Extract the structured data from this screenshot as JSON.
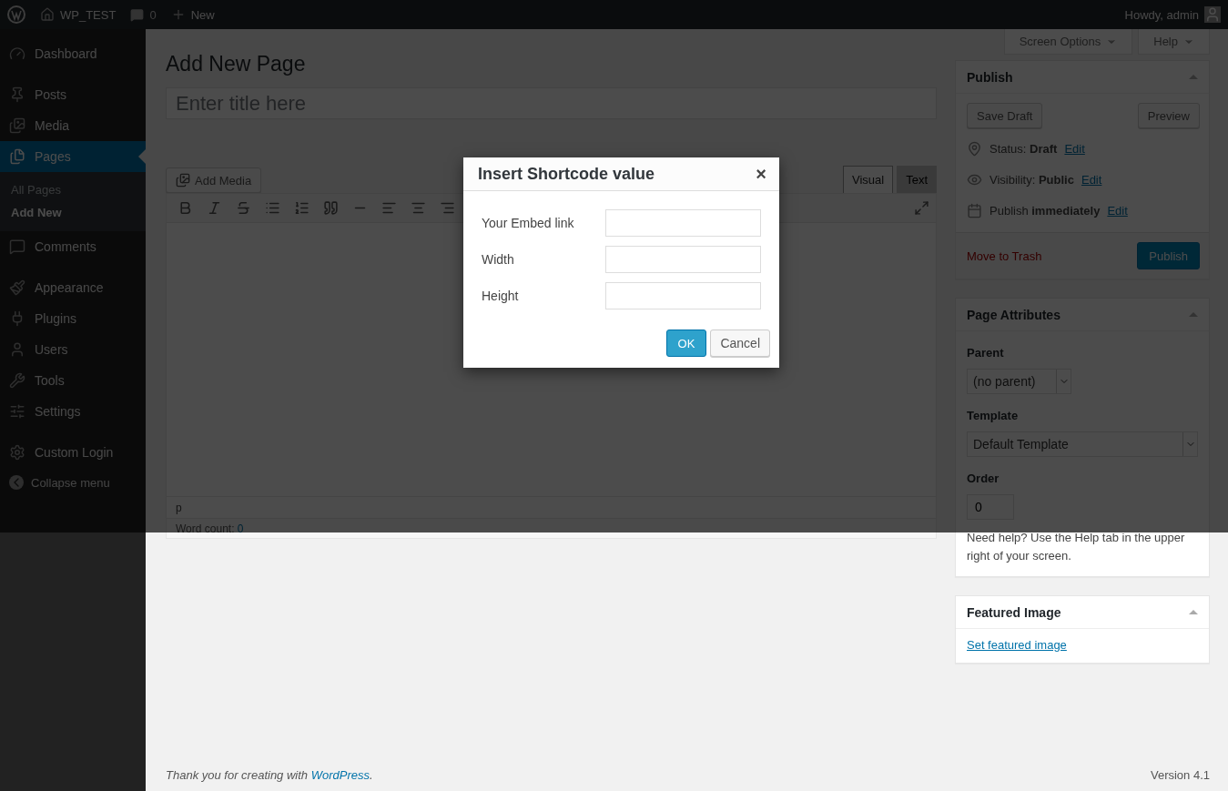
{
  "admin_bar": {
    "site": "WP_TEST",
    "comments": "0",
    "new": "New",
    "greeting": "Howdy, admin"
  },
  "sidebar": {
    "items": [
      {
        "label": "Dashboard",
        "selected": false
      },
      {
        "label": "Posts",
        "selected": false
      },
      {
        "label": "Media",
        "selected": false
      },
      {
        "label": "Pages",
        "selected": true,
        "children": [
          {
            "label": "All Pages",
            "selected": false
          },
          {
            "label": "Add New",
            "selected": true
          }
        ]
      },
      {
        "label": "Comments",
        "selected": false
      },
      {
        "label": "Appearance",
        "selected": false
      },
      {
        "label": "Plugins",
        "selected": false
      },
      {
        "label": "Users",
        "selected": false
      },
      {
        "label": "Tools",
        "selected": false
      },
      {
        "label": "Settings",
        "selected": false
      },
      {
        "label": "Custom Login",
        "selected": false
      }
    ],
    "collapse": "Collapse menu"
  },
  "screen_tabs": [
    "Screen Options",
    "Help"
  ],
  "heading": "Add New Page",
  "title_field": {
    "placeholder": "Enter title here"
  },
  "editor": {
    "add_media": "Add Media",
    "tabs": [
      {
        "label": "Visual",
        "selected": true
      },
      {
        "label": "Text",
        "selected": false
      }
    ],
    "path": "p",
    "word_count_label": "Word count: ",
    "word_count": "0"
  },
  "publish": {
    "title": "Publish",
    "save_draft": "Save Draft",
    "preview": "Preview",
    "rows": [
      {
        "text": "Status: **Draft**",
        "link": "Edit"
      },
      {
        "text": "Visibility: **Public**",
        "link": "Edit"
      },
      {
        "text": "Publish **immediately**",
        "link": "Edit"
      }
    ],
    "trash": "Move to Trash",
    "button": "Publish"
  },
  "page_attributes": {
    "title": "Page Attributes",
    "parent_label": "Parent",
    "parent": "(no parent)",
    "template_label": "Template",
    "template": "Default Template",
    "order_label": "Order",
    "order": "0",
    "help": "Need help? Use the Help tab in the upper right of your screen."
  },
  "featured_image": {
    "title": "Featured Image",
    "link": "Set featured image"
  },
  "footer": {
    "thanks": "Thank you for creating with ",
    "link": "WordPress",
    "end": ".",
    "version": "Version 4.1"
  },
  "modal": {
    "title": "Insert Shortcode value",
    "close": "×",
    "fields": [
      {
        "label": "Your Embed link"
      },
      {
        "label": "Width"
      },
      {
        "label": "Height"
      }
    ],
    "ok": "OK",
    "cancel": "Cancel"
  }
}
